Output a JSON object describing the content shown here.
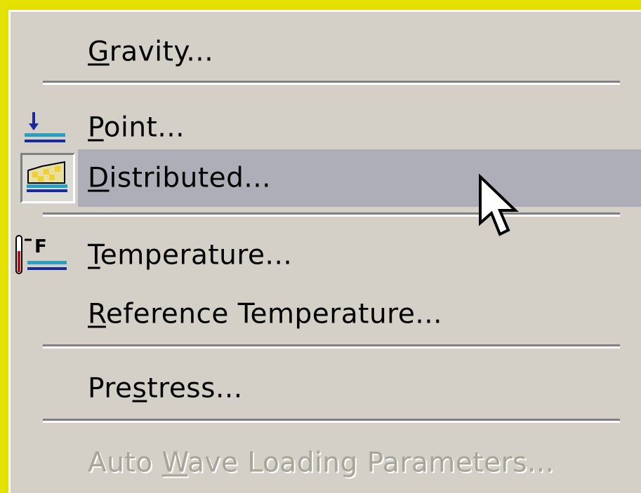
{
  "menu": {
    "items": [
      {
        "label_pre": "",
        "label_u": "G",
        "label_post": "ravity...",
        "icon": null,
        "state": "normal"
      },
      {
        "label_pre": "",
        "label_u": "P",
        "label_post": "oint...",
        "icon": "point-load-icon",
        "state": "normal"
      },
      {
        "label_pre": "",
        "label_u": "D",
        "label_post": "istributed...",
        "icon": "distributed-load-icon",
        "state": "highlighted"
      },
      {
        "label_pre": "",
        "label_u": "T",
        "label_post": "emperature...",
        "icon": "temperature-icon",
        "state": "normal"
      },
      {
        "label_pre": "",
        "label_u": "R",
        "label_post": "eference Temperature...",
        "icon": null,
        "state": "normal"
      },
      {
        "label_pre": "Pre",
        "label_u": "s",
        "label_post": "tress...",
        "icon": null,
        "state": "normal"
      },
      {
        "label_pre": "Auto ",
        "label_u": "W",
        "label_post": "ave Loading Parameters...",
        "icon": null,
        "state": "disabled"
      }
    ],
    "temperature_icon_letter": "F"
  },
  "colors": {
    "background": "#e4e000",
    "menu_face": "#d4d0c8",
    "highlight": "#aeaeb9",
    "disabled_text": "#a8a498"
  }
}
